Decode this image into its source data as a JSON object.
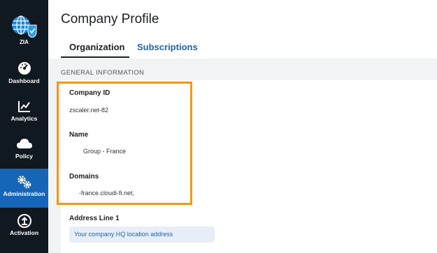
{
  "sidebar": {
    "logo_label": "ZIA",
    "items": [
      {
        "label": "Dashboard",
        "icon": "gauge-icon"
      },
      {
        "label": "Analytics",
        "icon": "line-chart-icon"
      },
      {
        "label": "Policy",
        "icon": "cloud-icon"
      },
      {
        "label": "Administration",
        "icon": "gears-icon"
      },
      {
        "label": "Activation",
        "icon": "upload-icon"
      }
    ],
    "active_item": "Administration",
    "colors": {
      "background": "#101820",
      "active": "#1565b8"
    }
  },
  "page": {
    "title": "Company Profile",
    "tabs": [
      {
        "label": "Organization",
        "selected": true
      },
      {
        "label": "Subscriptions",
        "selected": false
      }
    ]
  },
  "general": {
    "section_title": "GENERAL INFORMATION",
    "company_id_label": "Company ID",
    "company_id_value": "zscaler.net-82",
    "name_label": "Name",
    "name_value": "Group - France",
    "domains_label": "Domains",
    "domains_value": "-france.cloudi-fi.net,",
    "address_label": "Address Line 1",
    "address_placeholder": "Your company HQ location address"
  },
  "colors": {
    "highlight": "#f5960f",
    "link": "#1d64a8"
  }
}
